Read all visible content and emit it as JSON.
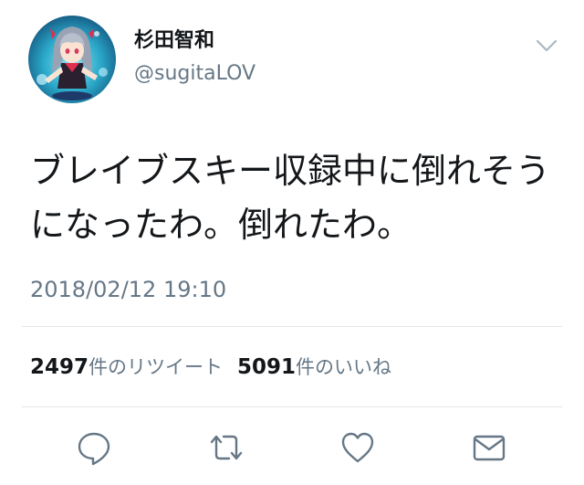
{
  "colors": {
    "text_primary": "#14171a",
    "text_secondary": "#657786",
    "divider": "#e1e8ed",
    "icon": "#657786"
  },
  "author": {
    "display_name": "杉田智和",
    "handle": "@sugitaLOV",
    "avatar_icon": "anime-character-avatar"
  },
  "header": {
    "menu_icon": "chevron-down-icon"
  },
  "tweet": {
    "text": "ブレイブスキー収録中に倒れそうになったわ。倒れたわ。",
    "timestamp": "2018/02/12 19:10"
  },
  "stats": {
    "retweet_count": "2497",
    "retweet_label": "件のリツイート",
    "like_count": "5091",
    "like_label": "件のいいね"
  },
  "actions": [
    {
      "icon": "reply-icon"
    },
    {
      "icon": "retweet-icon"
    },
    {
      "icon": "like-heart-icon"
    },
    {
      "icon": "direct-message-envelope-icon"
    }
  ]
}
